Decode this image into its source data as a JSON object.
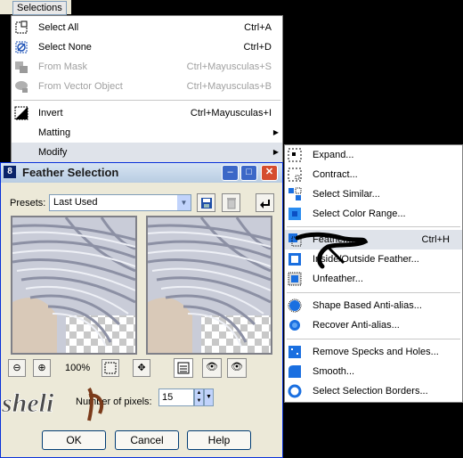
{
  "menubar": {
    "item": "Selections"
  },
  "main_menu": {
    "items": [
      {
        "label": "Select All",
        "shortcut": "Ctrl+A",
        "icon": "select-all-icon"
      },
      {
        "label": "Select None",
        "shortcut": "Ctrl+D",
        "icon": "select-none-icon"
      },
      {
        "label": "From Mask",
        "shortcut": "Ctrl+Mayusculas+S",
        "icon": "from-mask-icon",
        "disabled": true
      },
      {
        "label": "From Vector Object",
        "shortcut": "Ctrl+Mayusculas+B",
        "icon": "from-vector-icon",
        "disabled": true
      },
      {
        "label": "Invert",
        "shortcut": "Ctrl+Mayusculas+I",
        "icon": "invert-icon"
      },
      {
        "label": "Matting",
        "shortcut": "",
        "icon": ""
      },
      {
        "label": "Modify",
        "shortcut": "",
        "icon": ""
      }
    ]
  },
  "sub_menu": {
    "items": [
      {
        "label": "Expand...",
        "shortcut": ""
      },
      {
        "label": "Contract...",
        "shortcut": ""
      },
      {
        "label": "Select Similar...",
        "shortcut": ""
      },
      {
        "label": "Select Color Range...",
        "shortcut": ""
      },
      {
        "label": "Feather...",
        "shortcut": "Ctrl+H"
      },
      {
        "label": "Inside/Outside Feather...",
        "shortcut": ""
      },
      {
        "label": "Unfeather...",
        "shortcut": ""
      },
      {
        "label": "Shape Based Anti-alias...",
        "shortcut": ""
      },
      {
        "label": "Recover Anti-alias...",
        "shortcut": ""
      },
      {
        "label": "Remove Specks and Holes...",
        "shortcut": ""
      },
      {
        "label": "Smooth...",
        "shortcut": ""
      },
      {
        "label": "Select Selection Borders...",
        "shortcut": ""
      }
    ]
  },
  "dialog": {
    "icon_text": "8",
    "title": "Feather Selection",
    "presets_label": "Presets:",
    "preset_value": "Last Used",
    "zoom_level": "100%",
    "pixels_label": "Number of pixels:",
    "pixels_value": "15",
    "ok": "OK",
    "cancel": "Cancel",
    "help": "Help"
  },
  "watermark": {
    "text": "sheli"
  },
  "colors": {
    "title_bar": "#c7d8ec",
    "dialog_bg": "#ece9d8",
    "menu_bg": "#ffffff",
    "close_btn": "#d54c2e"
  }
}
